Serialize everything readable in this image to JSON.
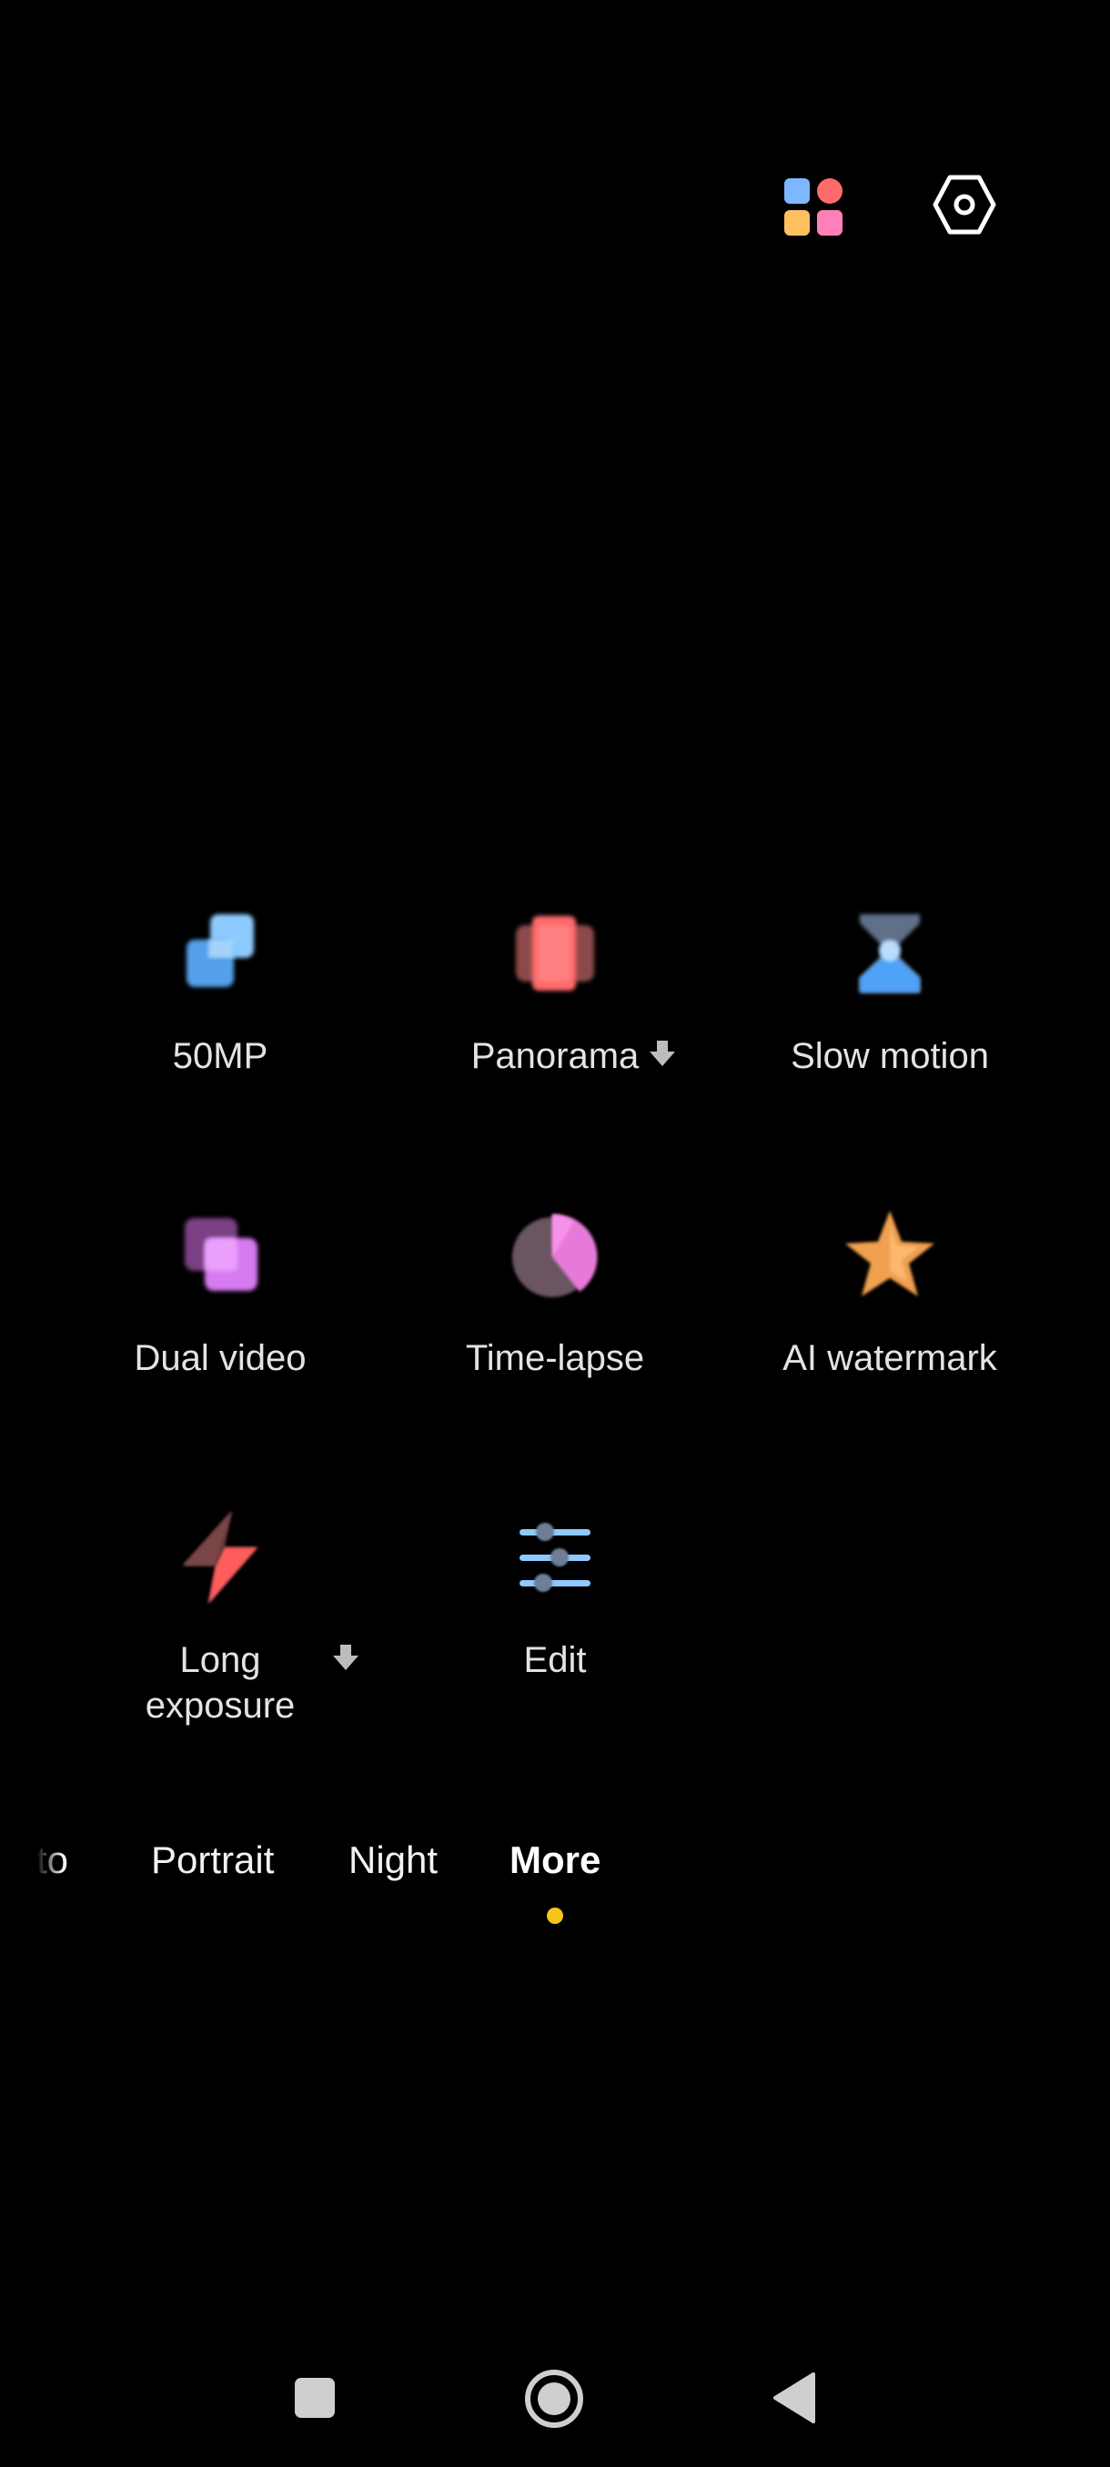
{
  "top_bar": {
    "apps_icon": "grid-apps-icon",
    "settings_icon": "hexagon-settings-icon"
  },
  "modes": [
    {
      "label": "50MP",
      "icon": "squares-icon",
      "downloadable": false
    },
    {
      "label": "Panorama",
      "icon": "panorama-icon",
      "downloadable": true
    },
    {
      "label": "Slow motion",
      "icon": "hourglass-icon",
      "downloadable": false
    },
    {
      "label": "Dual video",
      "icon": "dual-video-icon",
      "downloadable": false
    },
    {
      "label": "Time-lapse",
      "icon": "time-lapse-icon",
      "downloadable": false
    },
    {
      "label": "AI watermark",
      "icon": "star-icon",
      "downloadable": false
    },
    {
      "label": "Long exposure",
      "icon": "lightning-icon",
      "downloadable": true
    },
    {
      "label": "Edit",
      "icon": "sliders-icon",
      "downloadable": false
    }
  ],
  "tabs": [
    {
      "label": "to",
      "active": false
    },
    {
      "label": "Portrait",
      "active": false
    },
    {
      "label": "Night",
      "active": false
    },
    {
      "label": "More",
      "active": true
    }
  ],
  "colors": {
    "active_indicator": "#f5c518",
    "background": "#000000"
  },
  "nav": {
    "recents_icon": "square-recents-icon",
    "home_icon": "circle-home-icon",
    "back_icon": "triangle-back-icon"
  }
}
